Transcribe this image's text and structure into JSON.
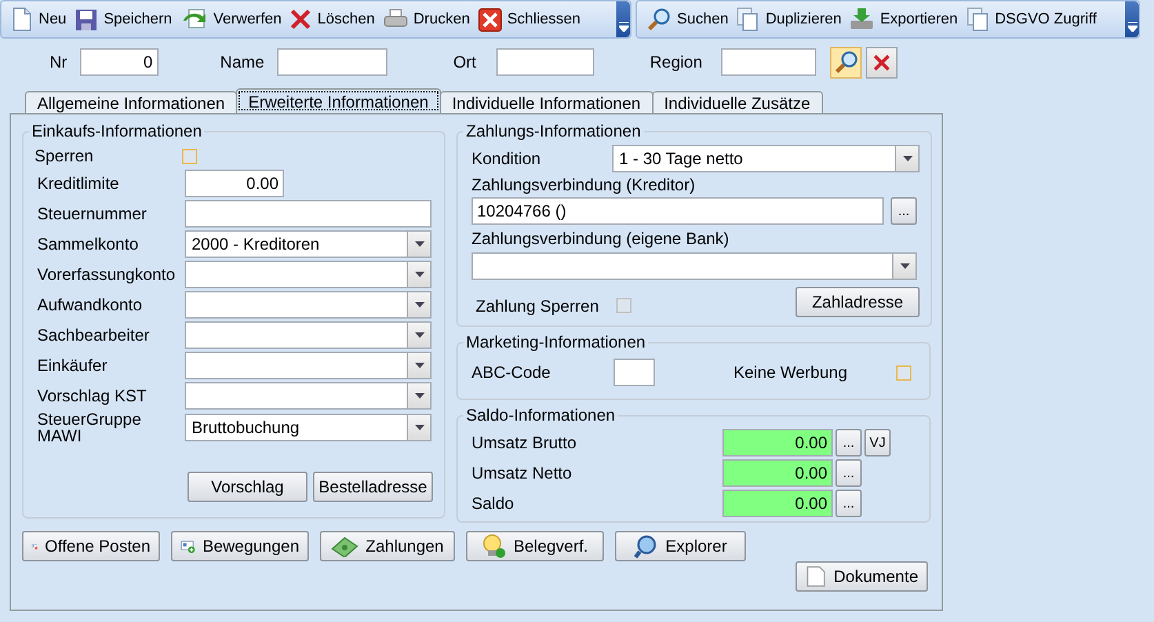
{
  "toolbar": {
    "groups": [
      {
        "items": [
          {
            "label": "Neu"
          },
          {
            "label": "Speichern"
          },
          {
            "label": "Verwerfen"
          },
          {
            "label": "Löschen"
          },
          {
            "label": "Drucken"
          },
          {
            "label": "Schliessen"
          }
        ]
      },
      {
        "items": [
          {
            "label": "Suchen"
          },
          {
            "label": "Duplizieren"
          },
          {
            "label": "Exportieren"
          },
          {
            "label": "DSGVO Zugriff"
          }
        ]
      }
    ]
  },
  "header": {
    "fields": [
      {
        "label": "Nr",
        "value": "0"
      },
      {
        "label": "Name"
      },
      {
        "label": "Ort"
      },
      {
        "label": "Region"
      }
    ]
  },
  "tabs": [
    {
      "label": "Allgemeine Informationen",
      "selected": false
    },
    {
      "label": "Erweiterte Informationen",
      "selected": true
    },
    {
      "label": "Individuelle Informationen",
      "selected": false
    },
    {
      "label": "Individuelle Zusätze",
      "selected": false
    }
  ],
  "einkauf": {
    "title": "Einkaufs-Informationen",
    "rows": [
      {
        "kind": "checkbox",
        "label": "Sperren",
        "checked": false
      },
      {
        "kind": "number",
        "label": "Kreditlimite",
        "value": "0.00"
      },
      {
        "kind": "text",
        "label": "Steuernummer"
      },
      {
        "kind": "combo",
        "label": "Sammelkonto",
        "value": "2000 - Kreditoren"
      },
      {
        "kind": "combo",
        "label": "Vorerfassungkonto"
      },
      {
        "kind": "combo",
        "label": "Aufwandkonto"
      },
      {
        "kind": "combo",
        "label": "Sachbearbeiter"
      },
      {
        "kind": "combo",
        "label": "Einkäufer"
      },
      {
        "kind": "combo",
        "label": "Vorschlag KST"
      },
      {
        "kind": "combo",
        "label": "SteuerGruppe MAWI",
        "value": "Bruttobuchung"
      }
    ],
    "buttons": [
      "Vorschlag",
      "Bestelladresse"
    ]
  },
  "zahlung": {
    "title": "Zahlungs-Informationen",
    "kondition": {
      "label": "Kondition",
      "value": "1 - 30 Tage netto"
    },
    "kreditor": {
      "label": "Zahlungsverbindung (Kreditor)",
      "value": "10204766 ()",
      "button": "..."
    },
    "bank": {
      "label": "Zahlungsverbindung (eigene Bank)"
    },
    "sperren": {
      "label": "Zahlung Sperren",
      "checked": false
    },
    "button": "Zahladresse"
  },
  "marketing": {
    "title": "Marketing-Informationen",
    "abc": {
      "label": "ABC-Code"
    },
    "werbung": {
      "label": "Keine Werbung",
      "checked": false
    }
  },
  "saldo": {
    "title": "Saldo-Informationen",
    "rows": [
      {
        "label": "Umsatz Brutto",
        "value": "0.00",
        "buttons": [
          "...",
          "VJ"
        ]
      },
      {
        "label": "Umsatz Netto",
        "value": "0.00",
        "buttons": [
          "..."
        ]
      },
      {
        "label": "Saldo",
        "value": "0.00",
        "buttons": [
          "..."
        ]
      }
    ]
  },
  "bottom_buttons": [
    "Offene Posten",
    "Bewegungen",
    "Zahlungen",
    "Belegverf.",
    "Explorer"
  ],
  "dokumente_button": "Dokumente"
}
